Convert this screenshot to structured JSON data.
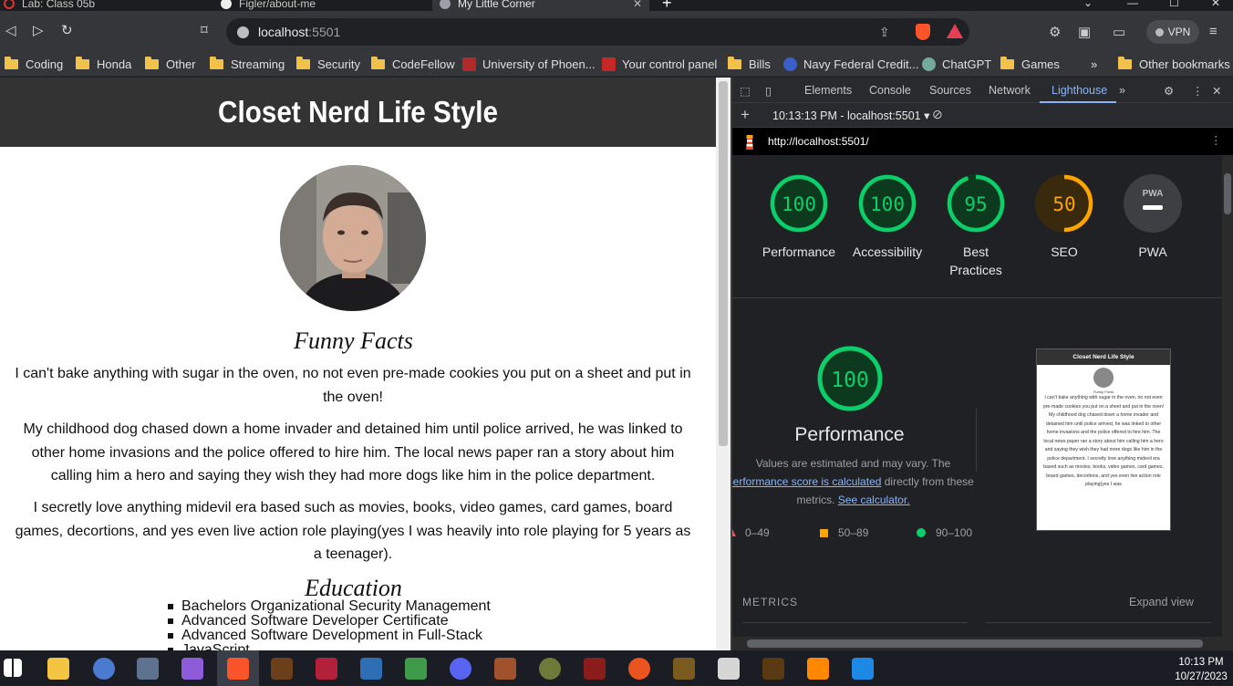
{
  "browser": {
    "tabs": [
      {
        "title": "Lab: Class 05b",
        "color": "#d33"
      },
      {
        "title": "Figler/about-me",
        "color": "#eee"
      },
      {
        "title": "My Little Corner",
        "color": "#9aa0a6"
      }
    ],
    "new_tab_label": "+",
    "url_host": "localhost",
    "url_port": ":5501",
    "vpn_label": "VPN",
    "bookmarks": [
      {
        "label": "Coding",
        "type": "folder"
      },
      {
        "label": "Honda",
        "type": "folder"
      },
      {
        "label": "Other",
        "type": "folder"
      },
      {
        "label": "Streaming",
        "type": "folder"
      },
      {
        "label": "Security",
        "type": "folder"
      },
      {
        "label": "CodeFellow",
        "type": "folder"
      },
      {
        "label": "University of Phoen...",
        "type": "site"
      },
      {
        "label": "Your control panel",
        "type": "site"
      },
      {
        "label": "Bills",
        "type": "folder"
      },
      {
        "label": "Navy Federal Credit...",
        "type": "site"
      },
      {
        "label": "ChatGPT",
        "type": "site"
      },
      {
        "label": "Games",
        "type": "folder"
      }
    ],
    "overflow_label": "»",
    "other_bookmarks_label": "Other bookmarks"
  },
  "page": {
    "title": "Closet Nerd Life Style",
    "funny_title": "Funny Facts",
    "facts": [
      "I can't bake anything with sugar in the oven, no not even pre-made cookies you put on a sheet and put in the oven!",
      "My childhood dog chased down a home invader and detained him until police arrived, he was linked to other home invasions and the police offered to hire him. The local news paper ran a story about him calling him a hero and saying they wish they had more dogs like him in the police department.",
      "I secretly love anything midevil era based such as movies, books, video games, card games, board games, decortions, and yes even live action role playing(yes I was heavily into role playing for 5 years as a teenager)."
    ],
    "education_title": "Education",
    "education": [
      "Bachelors Organizational Security Management",
      "Advanced Software Developer Certificate",
      "Advanced Software Development in Full-Stack",
      "JavaScript"
    ]
  },
  "devtools": {
    "tabs": [
      "Elements",
      "Console",
      "Sources",
      "Network",
      "Lighthouse"
    ],
    "active_tab": "Lighthouse",
    "report_selector": "10:13:13 PM - localhost:5501",
    "report_url": "http://localhost:5501/",
    "scores": [
      {
        "label": "Performance",
        "value": "100",
        "score": 100,
        "color": "#0cce6b"
      },
      {
        "label": "Accessibility",
        "value": "100",
        "score": 100,
        "color": "#0cce6b"
      },
      {
        "label": "Best Practices",
        "value": "95",
        "score": 95,
        "color": "#0cce6b"
      },
      {
        "label": "SEO",
        "value": "50",
        "score": 50,
        "color": "#ffa400"
      },
      {
        "label": "PWA",
        "value": "PWA",
        "score": null,
        "color": "#9aa0a6"
      }
    ],
    "main_score": "100",
    "main_title": "Performance",
    "note_line1": "Values are estimated and may vary. The",
    "note_link1": "performance score is calculated",
    "note_line2_suffix": " directly from these",
    "note_line3_prefix": "metrics. ",
    "note_link2": "See calculator.",
    "legend": [
      "0–49",
      "50–89",
      "90–100"
    ],
    "metrics_label": "METRICS",
    "expand_label": "Expand view",
    "thumb_title": "Closet Nerd Life Style",
    "thumb_heading": "Funny Facts",
    "thumb_text": "I can't bake anything with sugar in the oven, no not even pre-made cookies you put on a sheet and put in the oven! My childhood dog chased down a home invader and detained him until police arrived, he was linked to other home invasions and the police offered to hire him. The local news paper ran a story about him calling him a hero and saying they wish they had more dogs like him in the police department. I secretly love anything midevil era based such as movies, books, video games, card games, board games, decortions, and yes even live action role playing(yes I was"
  },
  "taskbar": {
    "time": "10:13 PM",
    "date": "10/27/2023"
  }
}
